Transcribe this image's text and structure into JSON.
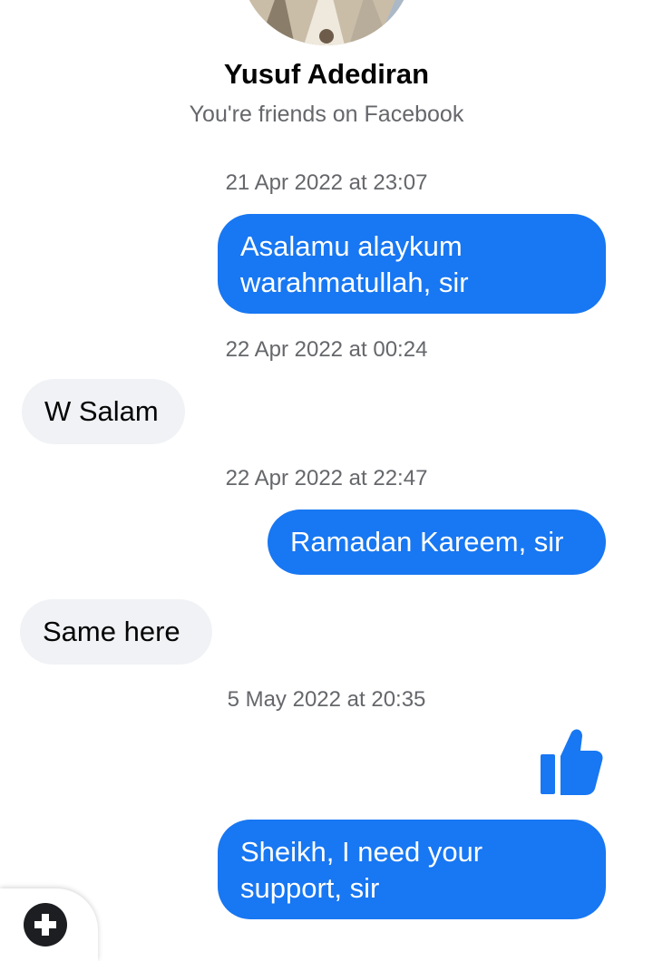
{
  "contact": {
    "name": "Yusuf Adediran",
    "status": "You're friends on Facebook"
  },
  "timestamps": [
    "21 Apr 2022 at 23:07",
    "22 Apr 2022 at 00:24",
    "22 Apr 2022 at 22:47",
    "5 May 2022 at 20:35"
  ],
  "messages": [
    {
      "direction": "outgoing",
      "text": "Asalamu alaykum\nwarahmatullah, sir"
    },
    {
      "direction": "incoming",
      "text": "W Salam"
    },
    {
      "direction": "outgoing",
      "text": "Ramadan Kareem, sir"
    },
    {
      "direction": "incoming",
      "text": "Same here"
    },
    {
      "direction": "outgoing",
      "type": "like",
      "icon": "thumbs-up-icon"
    },
    {
      "direction": "outgoing",
      "text": "Sheikh, I need your\nsupport, sir"
    }
  ],
  "colors": {
    "outgoing_bubble": "#1877f2",
    "incoming_bubble": "#f0f2f5",
    "secondary_text": "#65676b"
  }
}
